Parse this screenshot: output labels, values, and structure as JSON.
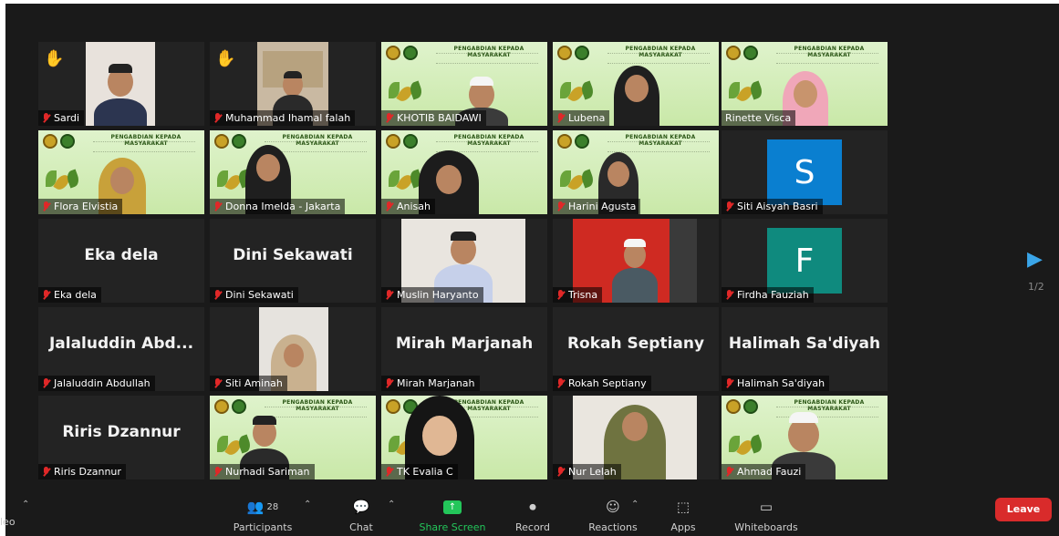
{
  "tiles": [
    {
      "name": "Sardi"
    },
    {
      "name": "Muhammad Ihamal falah"
    },
    {
      "name": "KHOTIB BAIDAWI"
    },
    {
      "name": "Lubena"
    },
    {
      "name": "Rinette Visca"
    },
    {
      "name": "Flora Elvistia"
    },
    {
      "name": "Donna Imelda - Jakarta"
    },
    {
      "name": "Anisah"
    },
    {
      "name": "Harini Agusta"
    },
    {
      "name": "Siti Aisyah Basri",
      "avatar_letter": "S"
    },
    {
      "name": "Eka dela",
      "display_name": "Eka dela"
    },
    {
      "name": "Dini Sekawati",
      "display_name": "Dini Sekawati"
    },
    {
      "name": "Muslin Haryanto"
    },
    {
      "name": "Trisna"
    },
    {
      "name": "Firdha Fauziah",
      "avatar_letter": "F"
    },
    {
      "name": "Jalaluddin Abdullah",
      "display_name": "Jalaluddin  Abd..."
    },
    {
      "name": "Siti Aminah"
    },
    {
      "name": "Mirah Marjanah",
      "display_name": "Mirah Marjanah"
    },
    {
      "name": "Rokah Septiany",
      "display_name": "Rokah Septiany"
    },
    {
      "name": "Halimah Sa'diyah",
      "display_name": "Halimah Sa'diyah"
    },
    {
      "name": "Riris Dzannur",
      "display_name": "Riris Dzannur"
    },
    {
      "name": "Nurhadi Sariman"
    },
    {
      "name": "TK Evalia C"
    },
    {
      "name": "Nur Lelah"
    },
    {
      "name": "Ahmad Fauzi"
    }
  ],
  "banner": {
    "title": "PENGABDIAN KEPADA MASYARAKAT"
  },
  "pager": {
    "indicator": "1/2"
  },
  "toolbar": {
    "video_fragment": "leo",
    "participants_label": "Participants",
    "participants_count": "28",
    "chat_label": "Chat",
    "share_label": "Share Screen",
    "record_label": "Record",
    "reactions_label": "Reactions",
    "apps_label": "Apps",
    "whiteboards_label": "Whiteboards",
    "leave_label": "Leave"
  },
  "colors": {
    "background": "#1a1a1a",
    "tile": "#232323",
    "active_speaker": "#f4f10a",
    "share_green": "#23c65a",
    "leave_red": "#d92b2b",
    "muted_red": "#e02828",
    "avatar_blue": "#0a7fd0",
    "avatar_teal": "#0f8a7e"
  }
}
